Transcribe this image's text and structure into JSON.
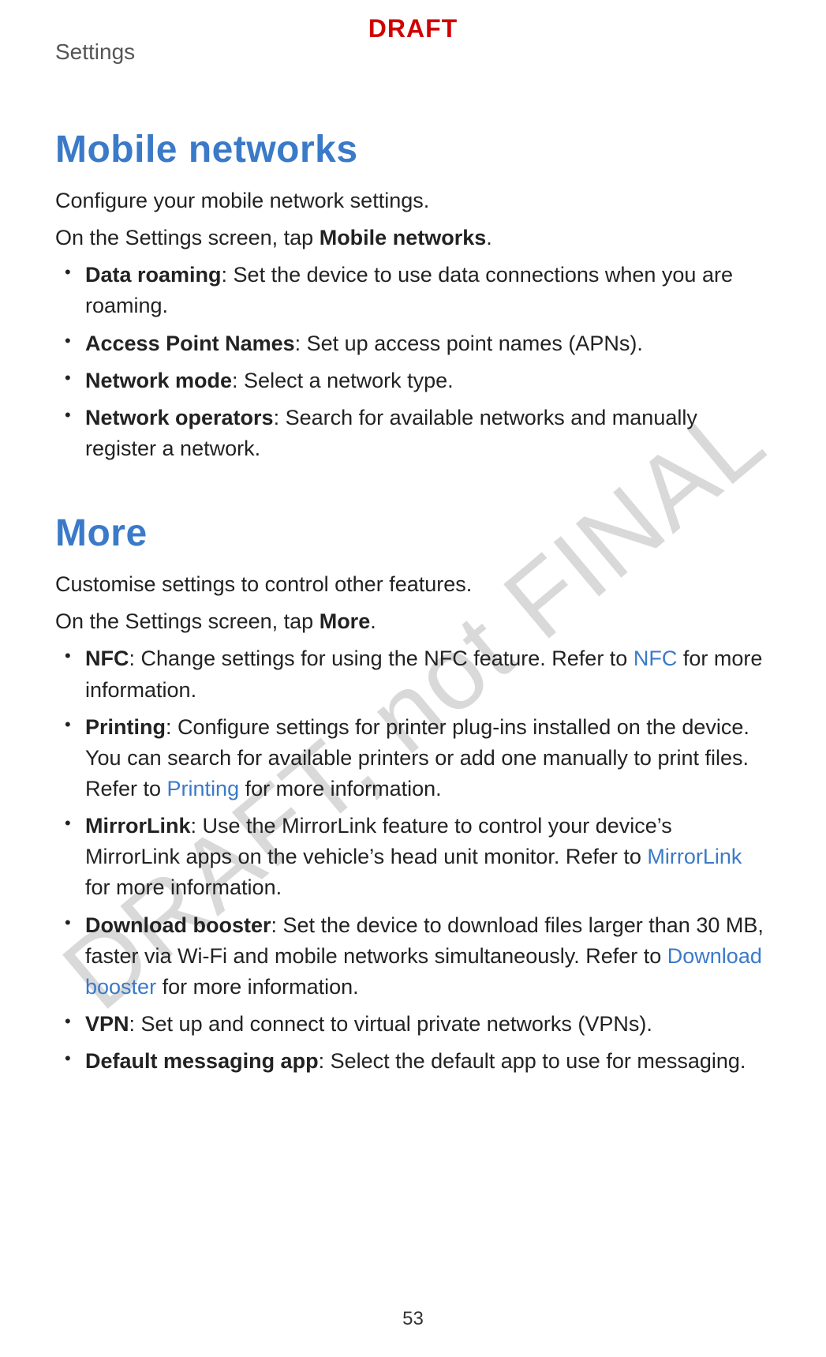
{
  "header": {
    "label": "Settings"
  },
  "stamps": {
    "draft_top": "DRAFT",
    "watermark": "DRAFT, not FINAL"
  },
  "page_number": "53",
  "section1": {
    "title": "Mobile networks",
    "intro1": "Configure your mobile network settings.",
    "intro2_pre": "On the Settings screen, tap ",
    "intro2_bold": "Mobile networks",
    "intro2_post": ".",
    "items": {
      "data_roaming_bold": "Data roaming",
      "data_roaming_rest": ": Set the device to use data connections when you are roaming.",
      "apn_bold": "Access Point Names",
      "apn_rest": ": Set up access point names (APNs).",
      "netmode_bold": "Network mode",
      "netmode_rest": ": Select a network type.",
      "netops_bold": "Network operators",
      "netops_rest": ": Search for available networks and manually register a network."
    }
  },
  "section2": {
    "title": "More",
    "intro1": "Customise settings to control other features.",
    "intro2_pre": "On the Settings screen, tap ",
    "intro2_bold": "More",
    "intro2_post": ".",
    "items": {
      "nfc_bold": "NFC",
      "nfc_pre": ": Change settings for using the NFC feature. Refer to ",
      "nfc_link": "NFC",
      "nfc_post": " for more information.",
      "printing_bold": "Printing",
      "printing_pre": ": Configure settings for printer plug-ins installed on the device. You can search for available printers or add one manually to print files. Refer to ",
      "printing_link": "Printing",
      "printing_post": " for more information.",
      "mirror_bold": "MirrorLink",
      "mirror_pre": ": Use the MirrorLink feature to control your device’s MirrorLink apps on the vehicle’s head unit monitor. Refer to ",
      "mirror_link": "MirrorLink",
      "mirror_post": " for more information.",
      "boost_bold": "Download booster",
      "boost_pre": ": Set the device to download files larger than 30 MB, faster via Wi-Fi and mobile networks simultaneously. Refer to ",
      "boost_link": "Download booster",
      "boost_post": " for more information.",
      "vpn_bold": "VPN",
      "vpn_rest": ": Set up and connect to virtual private networks (VPNs).",
      "msg_bold": "Default messaging app",
      "msg_rest": ": Select the default app to use for messaging."
    }
  }
}
